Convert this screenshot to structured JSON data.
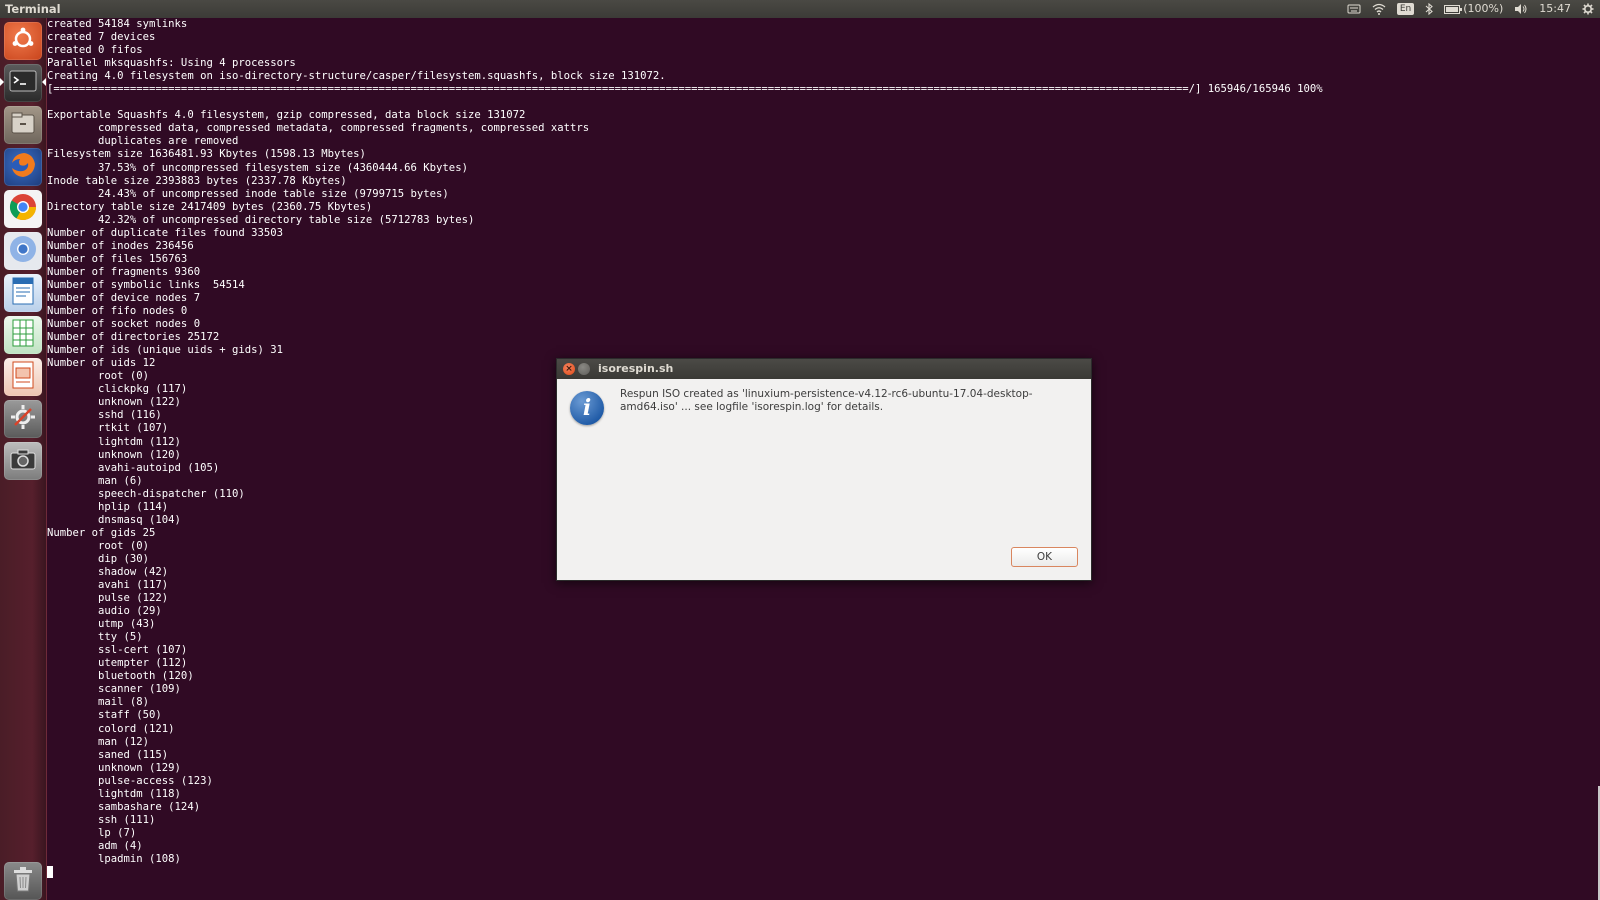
{
  "topbar": {
    "app_title": "Terminal",
    "language": "En",
    "battery": "(100%)",
    "clock": "15:47"
  },
  "launcher": {
    "items": [
      {
        "name": "ubuntu-dash-icon",
        "color": "#e05a2b"
      },
      {
        "name": "terminal-icon",
        "color": "#2c2c2c"
      },
      {
        "name": "files-icon",
        "color": "#8a7f72"
      },
      {
        "name": "firefox-icon",
        "color": "#e66000"
      },
      {
        "name": "chrome-icon",
        "color": "#4285f4"
      },
      {
        "name": "chromium-icon",
        "color": "#5a8fd8"
      },
      {
        "name": "writer-icon",
        "color": "#2a6db3"
      },
      {
        "name": "calc-icon",
        "color": "#2e9e3c"
      },
      {
        "name": "impress-icon",
        "color": "#d04a1c"
      },
      {
        "name": "settings-icon",
        "color": "#7a7a7a"
      },
      {
        "name": "camera-icon",
        "color": "#8c8c8c"
      },
      {
        "name": "trash-icon",
        "color": "#9a9a9a"
      }
    ]
  },
  "terminal": {
    "lines": [
      "created 54184 symlinks",
      "created 7 devices",
      "created 0 fifos",
      "Parallel mksquashfs: Using 4 processors",
      "Creating 4.0 filesystem on iso-directory-structure/casper/filesystem.squashfs, block size 131072.",
      "[==================================================================================================================================================================================/] 165946/165946 100%",
      "",
      "Exportable Squashfs 4.0 filesystem, gzip compressed, data block size 131072",
      "        compressed data, compressed metadata, compressed fragments, compressed xattrs",
      "        duplicates are removed",
      "Filesystem size 1636481.93 Kbytes (1598.13 Mbytes)",
      "        37.53% of uncompressed filesystem size (4360444.66 Kbytes)",
      "Inode table size 2393883 bytes (2337.78 Kbytes)",
      "        24.43% of uncompressed inode table size (9799715 bytes)",
      "Directory table size 2417409 bytes (2360.75 Kbytes)",
      "        42.32% of uncompressed directory table size (5712783 bytes)",
      "Number of duplicate files found 33503",
      "Number of inodes 236456",
      "Number of files 156763",
      "Number of fragments 9360",
      "Number of symbolic links  54514",
      "Number of device nodes 7",
      "Number of fifo nodes 0",
      "Number of socket nodes 0",
      "Number of directories 25172",
      "Number of ids (unique uids + gids) 31",
      "Number of uids 12",
      "        root (0)",
      "        clickpkg (117)",
      "        unknown (122)",
      "        sshd (116)",
      "        rtkit (107)",
      "        lightdm (112)",
      "        unknown (120)",
      "        avahi-autoipd (105)",
      "        man (6)",
      "        speech-dispatcher (110)",
      "        hplip (114)",
      "        dnsmasq (104)",
      "Number of gids 25",
      "        root (0)",
      "        dip (30)",
      "        shadow (42)",
      "        avahi (117)",
      "        pulse (122)",
      "        audio (29)",
      "        utmp (43)",
      "        tty (5)",
      "        ssl-cert (107)",
      "        utempter (112)",
      "        bluetooth (120)",
      "        scanner (109)",
      "        mail (8)",
      "        staff (50)",
      "        colord (121)",
      "        man (12)",
      "        saned (115)",
      "        unknown (129)",
      "        pulse-access (123)",
      "        lightdm (118)",
      "        sambashare (124)",
      "        ssh (111)",
      "        lp (7)",
      "        adm (4)",
      "        lpadmin (108)"
    ]
  },
  "dialog": {
    "title": "isorespin.sh",
    "close_glyph": "×",
    "icon_glyph": "i",
    "message": "Respun ISO created as 'linuxium-persistence-v4.12-rc6-ubuntu-17.04-desktop-amd64.iso' ... see logfile 'isorespin.log' for details.",
    "ok_label": "OK"
  }
}
